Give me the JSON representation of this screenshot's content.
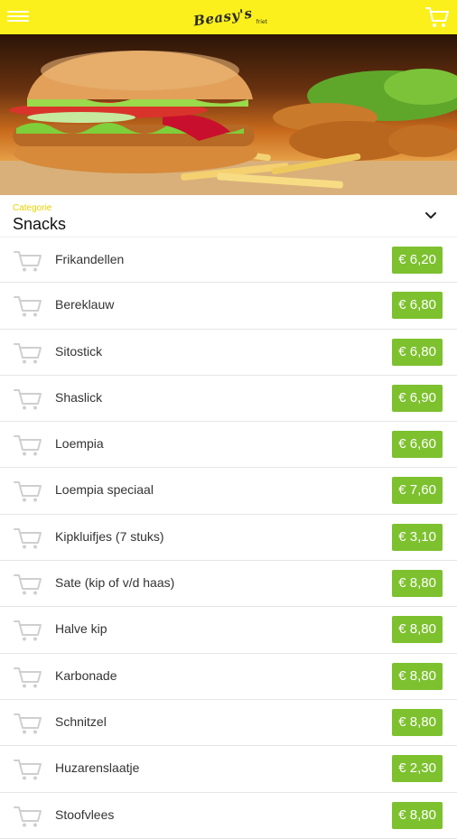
{
  "header": {
    "logo_text": "Beasy's",
    "logo_sub": "friet",
    "menu_icon": "hamburger-menu-icon",
    "cart_icon": "cart-icon"
  },
  "category": {
    "label": "Categorie",
    "value": "Snacks"
  },
  "colors": {
    "topbar": "#fbf01c",
    "price_badge": "#7dc12f",
    "category_label": "#e6d300"
  },
  "items": [
    {
      "name": "Frikandellen",
      "price": "€ 6,20"
    },
    {
      "name": "Bereklauw",
      "price": "€ 6,80"
    },
    {
      "name": "Sitostick",
      "price": "€ 6,80"
    },
    {
      "name": "Shaslick",
      "price": "€ 6,90"
    },
    {
      "name": "Loempia",
      "price": "€ 6,60"
    },
    {
      "name": "Loempia speciaal",
      "price": "€ 7,60"
    },
    {
      "name": "Kipkluifjes (7 stuks)",
      "price": "€ 3,10"
    },
    {
      "name": "Sate (kip of v/d haas)",
      "price": "€ 8,80"
    },
    {
      "name": "Halve kip",
      "price": "€ 8,80"
    },
    {
      "name": "Karbonade",
      "price": "€ 8,80"
    },
    {
      "name": "Schnitzel",
      "price": "€ 8,80"
    },
    {
      "name": "Huzarenslaatje",
      "price": "€ 2,30"
    },
    {
      "name": "Stoofvlees",
      "price": "€ 8,80"
    }
  ]
}
